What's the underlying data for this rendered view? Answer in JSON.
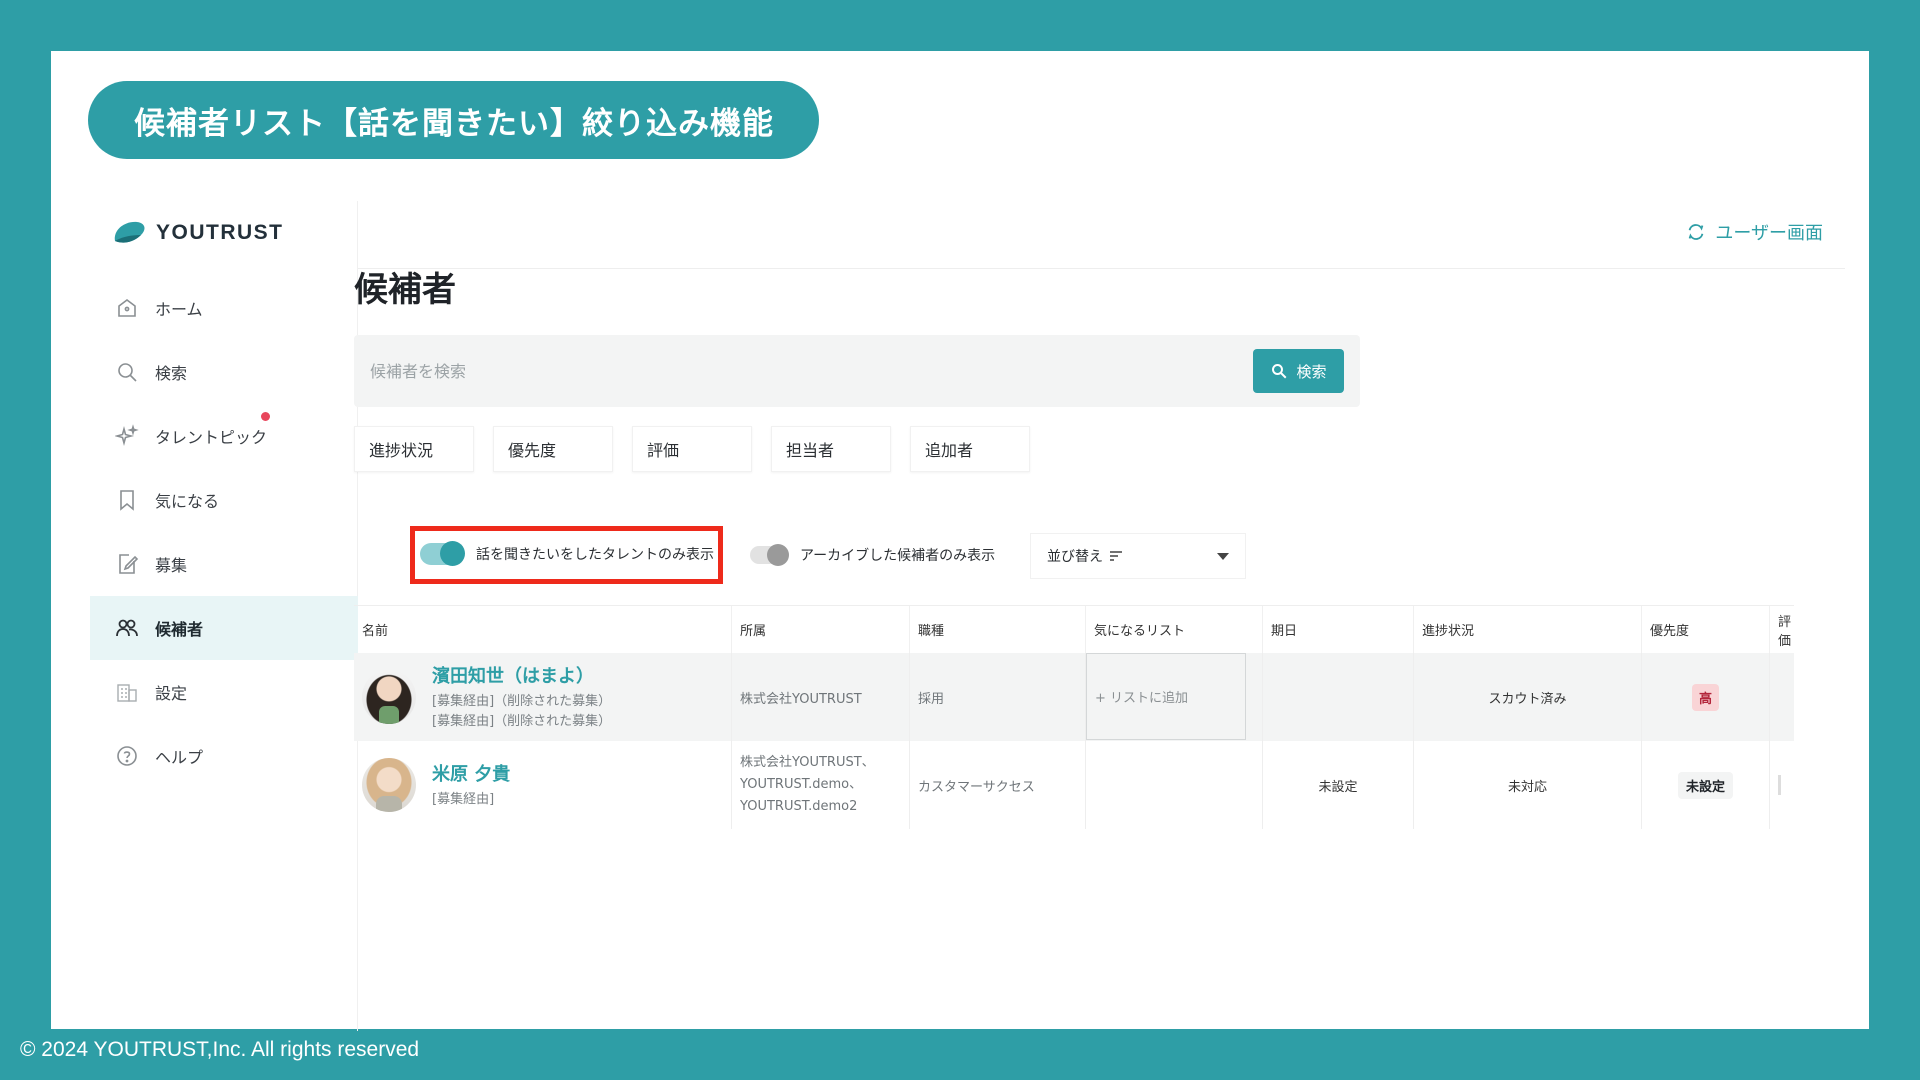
{
  "banner": {
    "title": "候補者リスト【話を聞きたい】絞り込み機能"
  },
  "footer": {
    "copyright": "© 2024 YOUTRUST,Inc. All rights reserved"
  },
  "brand": {
    "logo_text": "YOUTRUST",
    "accent": "#2e9ea6",
    "highlight": "#ee2a1b",
    "notification_dot": "#e8465c"
  },
  "sidebar": {
    "items": [
      {
        "label": "ホーム",
        "icon": "home-icon",
        "active": false
      },
      {
        "label": "検索",
        "icon": "search-icon",
        "active": false
      },
      {
        "label": "タレントピック",
        "icon": "sparkle-icon",
        "active": false,
        "has_dot": true
      },
      {
        "label": "気になる",
        "icon": "bookmark-icon",
        "active": false
      },
      {
        "label": "募集",
        "icon": "edit-icon",
        "active": false
      },
      {
        "label": "候補者",
        "icon": "people-icon",
        "active": true
      },
      {
        "label": "設定",
        "icon": "building-icon",
        "active": false
      },
      {
        "label": "ヘルプ",
        "icon": "help-icon",
        "active": false
      }
    ]
  },
  "header": {
    "user_view_label": "ユーザー画面"
  },
  "page": {
    "title": "候補者"
  },
  "search": {
    "placeholder": "候補者を検索",
    "button_label": "検索"
  },
  "filters": [
    "進捗状況",
    "優先度",
    "評価",
    "担当者",
    "追加者"
  ],
  "toggles": {
    "interested_only": {
      "label": "話を聞きたいをしたタレントのみ表示",
      "on": true
    },
    "archived_only": {
      "label": "アーカイブした候補者のみ表示",
      "on": false
    }
  },
  "sort": {
    "label": "並び替え"
  },
  "table": {
    "columns": [
      "名前",
      "所属",
      "職種",
      "気になるリスト",
      "期日",
      "進捗状況",
      "優先度",
      "評価"
    ],
    "rows": [
      {
        "name": "濱田知世（はまよ）",
        "sub1": "[募集経由]（削除された募集）",
        "sub2": "[募集経由]（削除された募集）",
        "org": "株式会社YOUTRUST",
        "job": "採用",
        "list_action": "+ リストに追加",
        "date": "",
        "status": "スカウト済み",
        "priority": "高"
      },
      {
        "name": "米原 夕貴",
        "sub1": "[募集経由]",
        "org1": "株式会社YOUTRUST、",
        "org2": "YOUTRUST.demo、",
        "org3": "YOUTRUST.demo2",
        "job": "カスタマーサクセス",
        "date": "未設定",
        "status": "未対応",
        "priority": "未設定"
      }
    ]
  }
}
